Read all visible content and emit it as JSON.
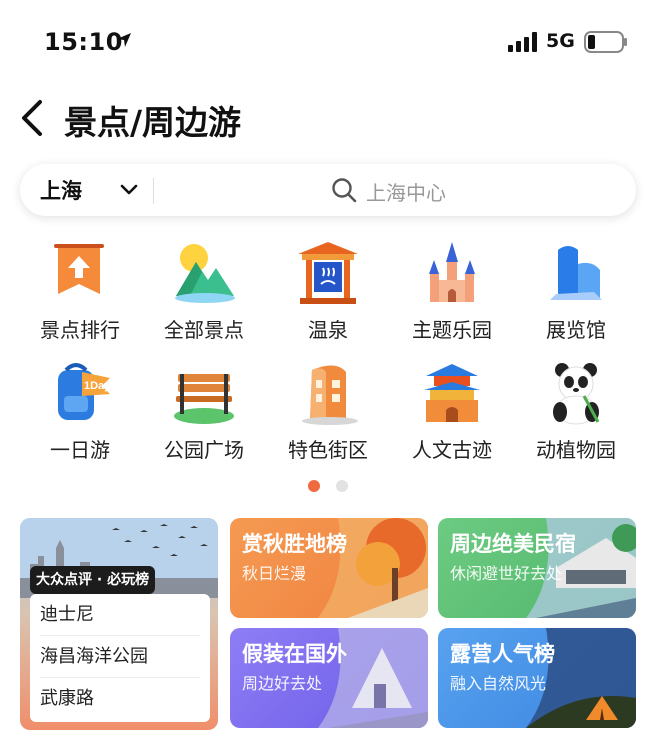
{
  "status": {
    "time": "15:10",
    "network": "5G"
  },
  "header": {
    "title": "景点/周边游"
  },
  "search": {
    "city": "上海",
    "placeholder": "上海中心"
  },
  "categories": [
    {
      "label": "景点排行",
      "icon": "ranking-flag-icon"
    },
    {
      "label": "全部景点",
      "icon": "mountains-icon"
    },
    {
      "label": "温泉",
      "icon": "hot-spring-icon"
    },
    {
      "label": "主题乐园",
      "icon": "castle-icon"
    },
    {
      "label": "展览馆",
      "icon": "exhibition-hall-icon"
    },
    {
      "label": "一日游",
      "icon": "backpack-icon"
    },
    {
      "label": "公园广场",
      "icon": "park-bench-icon"
    },
    {
      "label": "特色街区",
      "icon": "street-building-icon"
    },
    {
      "label": "人文古迹",
      "icon": "pagoda-icon"
    },
    {
      "label": "动植物园",
      "icon": "panda-icon"
    }
  ],
  "badge_backpack": "1Day",
  "pagination": {
    "pages": 2,
    "current": 1
  },
  "ranking_card": {
    "brand": "大众点评",
    "sep": "·",
    "tag": "必玩榜",
    "items": [
      "迪士尼",
      "海昌海洋公园",
      "武康路"
    ]
  },
  "cards": [
    {
      "title": "赏秋胜地榜",
      "subtitle": "秋日烂漫",
      "color": "#f08b4a"
    },
    {
      "title": "周边绝美民宿",
      "subtitle": "休闲避世好去处",
      "color": "#5dc07a"
    },
    {
      "title": "假装在国外",
      "subtitle": "周边好去处",
      "color": "#7b6cf0"
    },
    {
      "title": "露营人气榜",
      "subtitle": "融入自然风光",
      "color": "#3f8fe8"
    }
  ],
  "colors": {
    "accent": "#ef6b3f",
    "text": "#111111"
  }
}
